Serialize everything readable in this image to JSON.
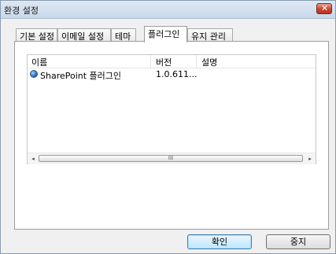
{
  "window": {
    "title": "환경 설정"
  },
  "titlebar": {
    "close_glyph": "✕"
  },
  "tabs": [
    {
      "label": "기본 설정"
    },
    {
      "label": "이메일 설정"
    },
    {
      "label": "테마"
    },
    {
      "label": "플러그인",
      "active": true
    },
    {
      "label": "유지 관리"
    }
  ],
  "plugins": {
    "columns": [
      "이름",
      "버전",
      "설명"
    ],
    "rows": [
      {
        "icon": "globe-icon",
        "name": "SharePoint 플러그인",
        "version": "1.0.611...",
        "description": ""
      }
    ],
    "scrollbar": {
      "left": "◂",
      "thumb": "III",
      "right": "▸"
    }
  },
  "buttons": {
    "ok": "확인",
    "cancel": "중지"
  }
}
